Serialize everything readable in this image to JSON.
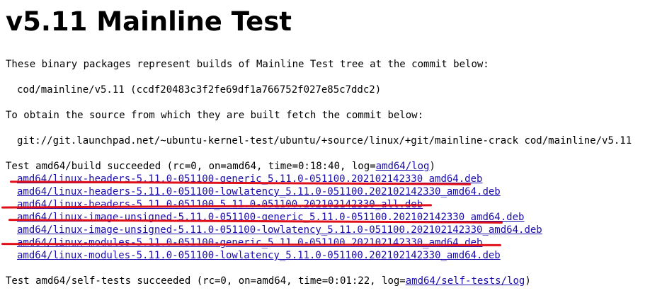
{
  "page": {
    "title": "v5.11 Mainline Test",
    "intro": "These binary packages represent builds of Mainline Test tree at the commit below:",
    "commit": "cod/mainline/v5.11 (ccdf20483c3f2fe69df1a766752f027e85c7ddc2)",
    "obtain_text": "To obtain the source from which they are built fetch the commit below:",
    "git_command": "git://git.launchpad.net/~ubuntu-kernel-test/ubuntu/+source/linux/+git/mainline-crack cod/mainline/v5.11"
  },
  "build": {
    "prefix": "Test amd64/build succeeded (rc=0, on=amd64, time=0:18:40, log=",
    "log_link": "amd64/log",
    "suffix": ")"
  },
  "packages": [
    "amd64/linux-headers-5.11.0-051100-generic_5.11.0-051100.202102142330_amd64.deb",
    "amd64/linux-headers-5.11.0-051100-lowlatency_5.11.0-051100.202102142330_amd64.deb",
    "amd64/linux-headers-5.11.0-051100_5.11.0-051100.202102142330_all.deb",
    "amd64/linux-image-unsigned-5.11.0-051100-generic_5.11.0-051100.202102142330_amd64.deb",
    "amd64/linux-image-unsigned-5.11.0-051100-lowlatency_5.11.0-051100.202102142330_amd64.deb",
    "amd64/linux-modules-5.11.0-051100-generic_5.11.0-051100.202102142330_amd64.deb",
    "amd64/linux-modules-5.11.0-051100-lowlatency_5.11.0-051100.202102142330_amd64.deb"
  ],
  "selftests": {
    "prefix": "Test amd64/self-tests succeeded (rc=0, on=amd64, time=0:01:22, log=",
    "log_link": "amd64/self-tests/log",
    "suffix": ")"
  },
  "annotation": {
    "color": "#e0101a",
    "highlighted_packages": [
      0,
      2,
      3,
      5
    ]
  }
}
